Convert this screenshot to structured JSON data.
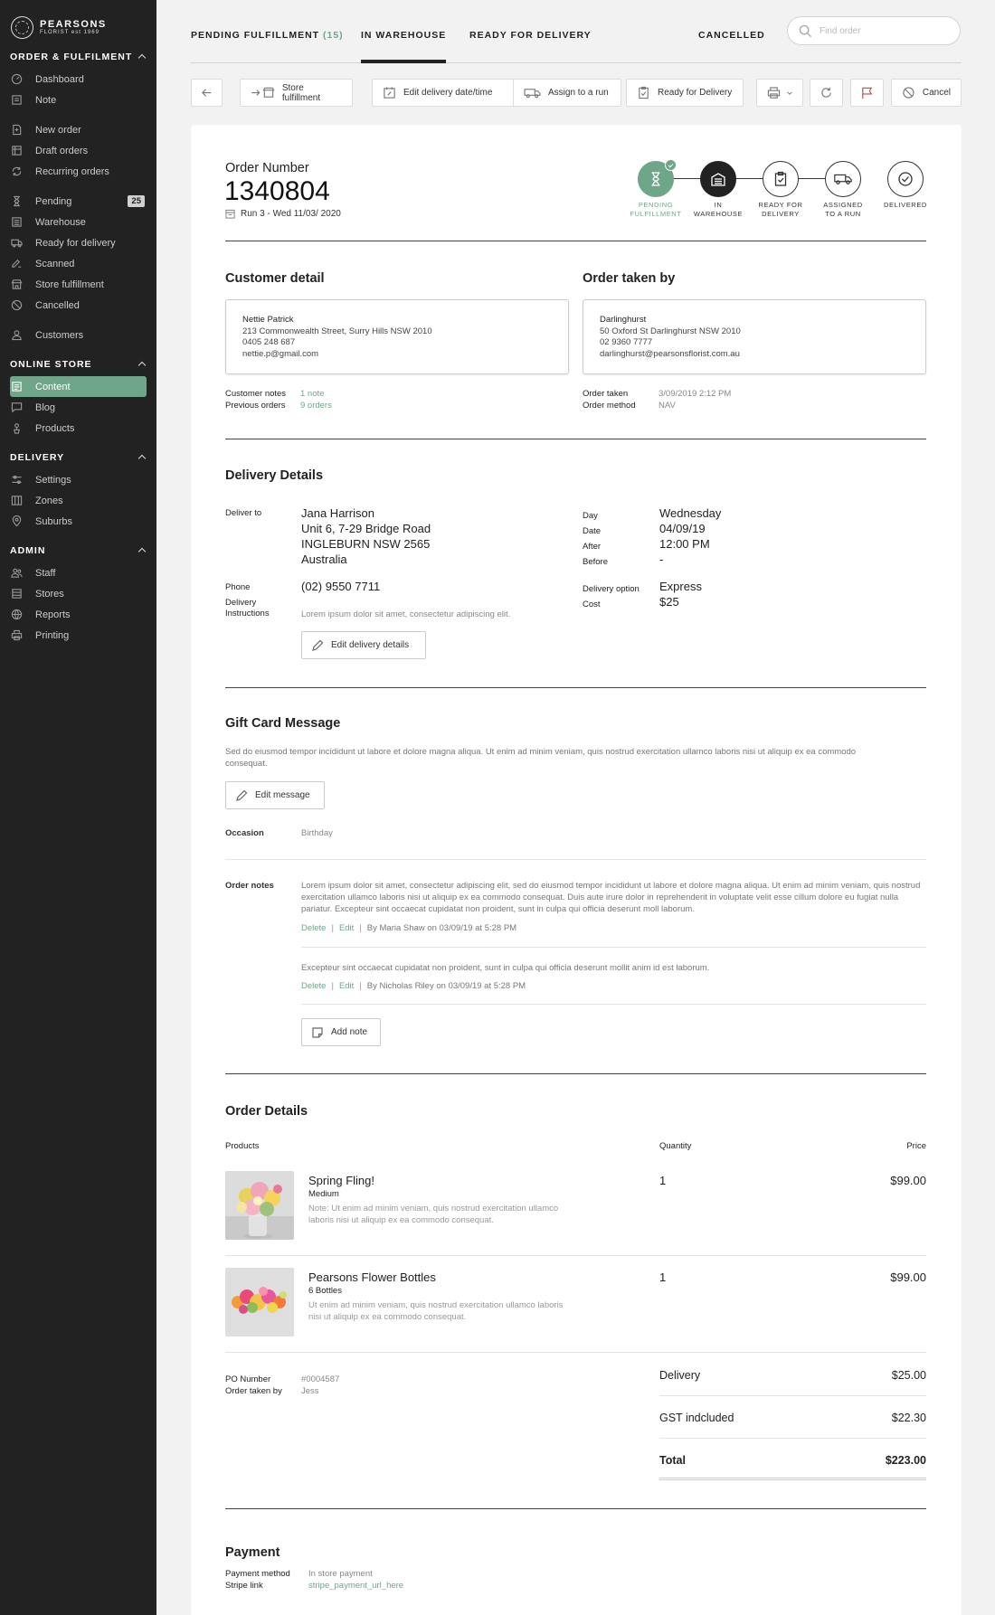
{
  "brand": {
    "name": "PEARSONS",
    "sub": "FLORIST est 1969"
  },
  "sidebar": {
    "sections": [
      {
        "title": "ORDER & FULFILMENT"
      },
      {
        "title": "ONLINE STORE"
      },
      {
        "title": "DELIVERY"
      },
      {
        "title": "ADMIN"
      }
    ],
    "items": {
      "dashboard": "Dashboard",
      "note": "Note",
      "new_order": "New order",
      "draft_orders": "Draft orders",
      "recurring_orders": "Recurring orders",
      "pending": "Pending",
      "pending_badge": "25",
      "warehouse": "Warehouse",
      "ready_for_delivery": "Ready for delivery",
      "scanned": "Scanned",
      "store_fulfillment": "Store fulfillment",
      "cancelled": "Cancelled",
      "customers": "Customers",
      "content": "Content",
      "blog": "Blog",
      "products": "Products",
      "settings": "Settings",
      "zones": "Zones",
      "suburbs": "Suburbs",
      "staff": "Staff",
      "stores": "Stores",
      "reports": "Reports",
      "printing": "Printing"
    }
  },
  "tabs": {
    "pending": "PENDING FULFILLMENT",
    "pending_count": "(15)",
    "warehouse": "IN WAREHOUSE",
    "ready": "READY FOR DELIVERY",
    "cancelled": "CANCELLED"
  },
  "search": {
    "placeholder": "Find order"
  },
  "toolbar": {
    "store_fulfillment": "Store fulfillment",
    "edit_delivery": "Edit delivery date/time",
    "assign_run": "Assign to a run",
    "ready_delivery": "Ready for Delivery",
    "cancel": "Cancel"
  },
  "order": {
    "label": "Order Number",
    "number": "1340804",
    "run": "Run 3 - Wed 11/03/ 2020"
  },
  "steps": {
    "pending_l1": "PENDING",
    "pending_l2": "FULFILLMENT",
    "warehouse_l1": "IN",
    "warehouse_l2": "WAREHOUSE",
    "ready_l1": "READY FOR",
    "ready_l2": "DELIVERY",
    "assigned_l1": "ASSIGNED",
    "assigned_l2": "TO A RUN",
    "delivered_l1": "DELIVERED"
  },
  "customer": {
    "heading": "Customer detail",
    "name": "Nettie Patrick",
    "address": "213 Commonwealth Street, Surry Hills NSW 2010",
    "phone": "0405 248 687",
    "email": "nettie.p@gmail.com",
    "notes_label": "Customer notes",
    "notes_value": "1 note",
    "prev_label": "Previous orders",
    "prev_value": "9 orders"
  },
  "taken_by": {
    "heading": "Order taken by",
    "name": "Darlinghurst",
    "address": "50 Oxford St Darlinghurst NSW 2010",
    "phone": "02 9360 7777",
    "email": "darlinghurst@pearsonsflorist.com.au",
    "taken_label": "Order taken",
    "taken_value": "3/09/2019 2:12 PM",
    "method_label": "Order method",
    "method_value": "NAV"
  },
  "delivery": {
    "heading": "Delivery Details",
    "deliver_to_label": "Deliver to",
    "recipient": "Jana Harrison",
    "addr1": "Unit 6, 7-29 Bridge Road",
    "addr2": "INGLEBURN NSW 2565",
    "addr3": "Australia",
    "phone_label": "Phone",
    "phone": "(02) 9550 7711",
    "instr_label1": "Delivery",
    "instr_label2": "Instructions",
    "instructions": "Lorem ipsum dolor sit amet, consectetur adipiscing elit.",
    "edit_button": "Edit delivery details",
    "day_label": "Day",
    "day": "Wednesday",
    "date_label": "Date",
    "date": "04/09/19",
    "after_label": "After",
    "after": "12:00 PM",
    "before_label": "Before",
    "before": "-",
    "option_label": "Delivery option",
    "option": "Express",
    "cost_label": "Cost",
    "cost": "$25"
  },
  "gift": {
    "heading": "Gift Card Message",
    "message": "Sed do eiusmod tempor incididunt ut labore et dolore magna aliqua. Ut enim ad minim veniam, quis nostrud exercitation ullamco laboris nisi ut aliquip ex ea commodo consequat.",
    "edit_button": "Edit message",
    "occasion_label": "Occasion",
    "occasion": "Birthday"
  },
  "notes": {
    "label": "Order notes",
    "items": [
      {
        "text": "Lorem ipsum dolor sit amet, consectetur adipiscing elit, sed do eiusmod tempor incididunt ut labore et dolore magna aliqua. Ut enim ad minim veniam, quis nostrud exercitation ullamco laboris nisi ut aliquip ex ea commodo consequat. Duis aute irure dolor in reprehenderit in voluptate velit esse cillum dolore eu fugiat nulla pariatur. Excepteur sint occaecat cupidatat non proident, sunt in culpa qui officia deserunt moll laborum.",
        "delete": "Delete",
        "edit": "Edit",
        "byline": "By Maria Shaw on 03/09/19 at 5:28 PM"
      },
      {
        "text": "Excepteur sint occaecat cupidatat non proident, sunt in culpa qui officia deserunt mollit anim id est laborum.",
        "delete": "Delete",
        "edit": "Edit",
        "byline": "By Nicholas Riley on 03/09/19 at 5:28 PM"
      }
    ],
    "add_button": "Add note"
  },
  "order_details": {
    "heading": "Order Details",
    "col_products": "Products",
    "col_qty": "Quantity",
    "col_price": "Price",
    "products": [
      {
        "name": "Spring Fling!",
        "variant": "Medium",
        "note": "Note: Ut enim ad minim veniam, quis nostrud exercitation ullamco laboris nisi ut aliquip ex ea commodo consequat.",
        "qty": "1",
        "price": "$99.00"
      },
      {
        "name": "Pearsons Flower Bottles",
        "variant": "6 Bottles",
        "note": "Ut enim ad minim veniam, quis nostrud exercitation ullamco laboris nisi ut aliquip ex ea commodo consequat.",
        "qty": "1",
        "price": "$99.00"
      }
    ],
    "po_label": "PO Number",
    "po": "#0004587",
    "taken_label": "Order taken by",
    "taken": "Jess",
    "delivery_label": "Delivery",
    "delivery": "$25.00",
    "gst_label": "GST indcluded",
    "gst": "$22.30",
    "total_label": "Total",
    "total": "$223.00"
  },
  "payment": {
    "heading": "Payment",
    "method_label": "Payment method",
    "method": "In store payment",
    "stripe_label": "Stripe link",
    "stripe": "stripe_payment_url_here"
  },
  "colors": {
    "accent": "#6fa589",
    "sidebar": "#222222",
    "background": "#f2f2f2"
  }
}
